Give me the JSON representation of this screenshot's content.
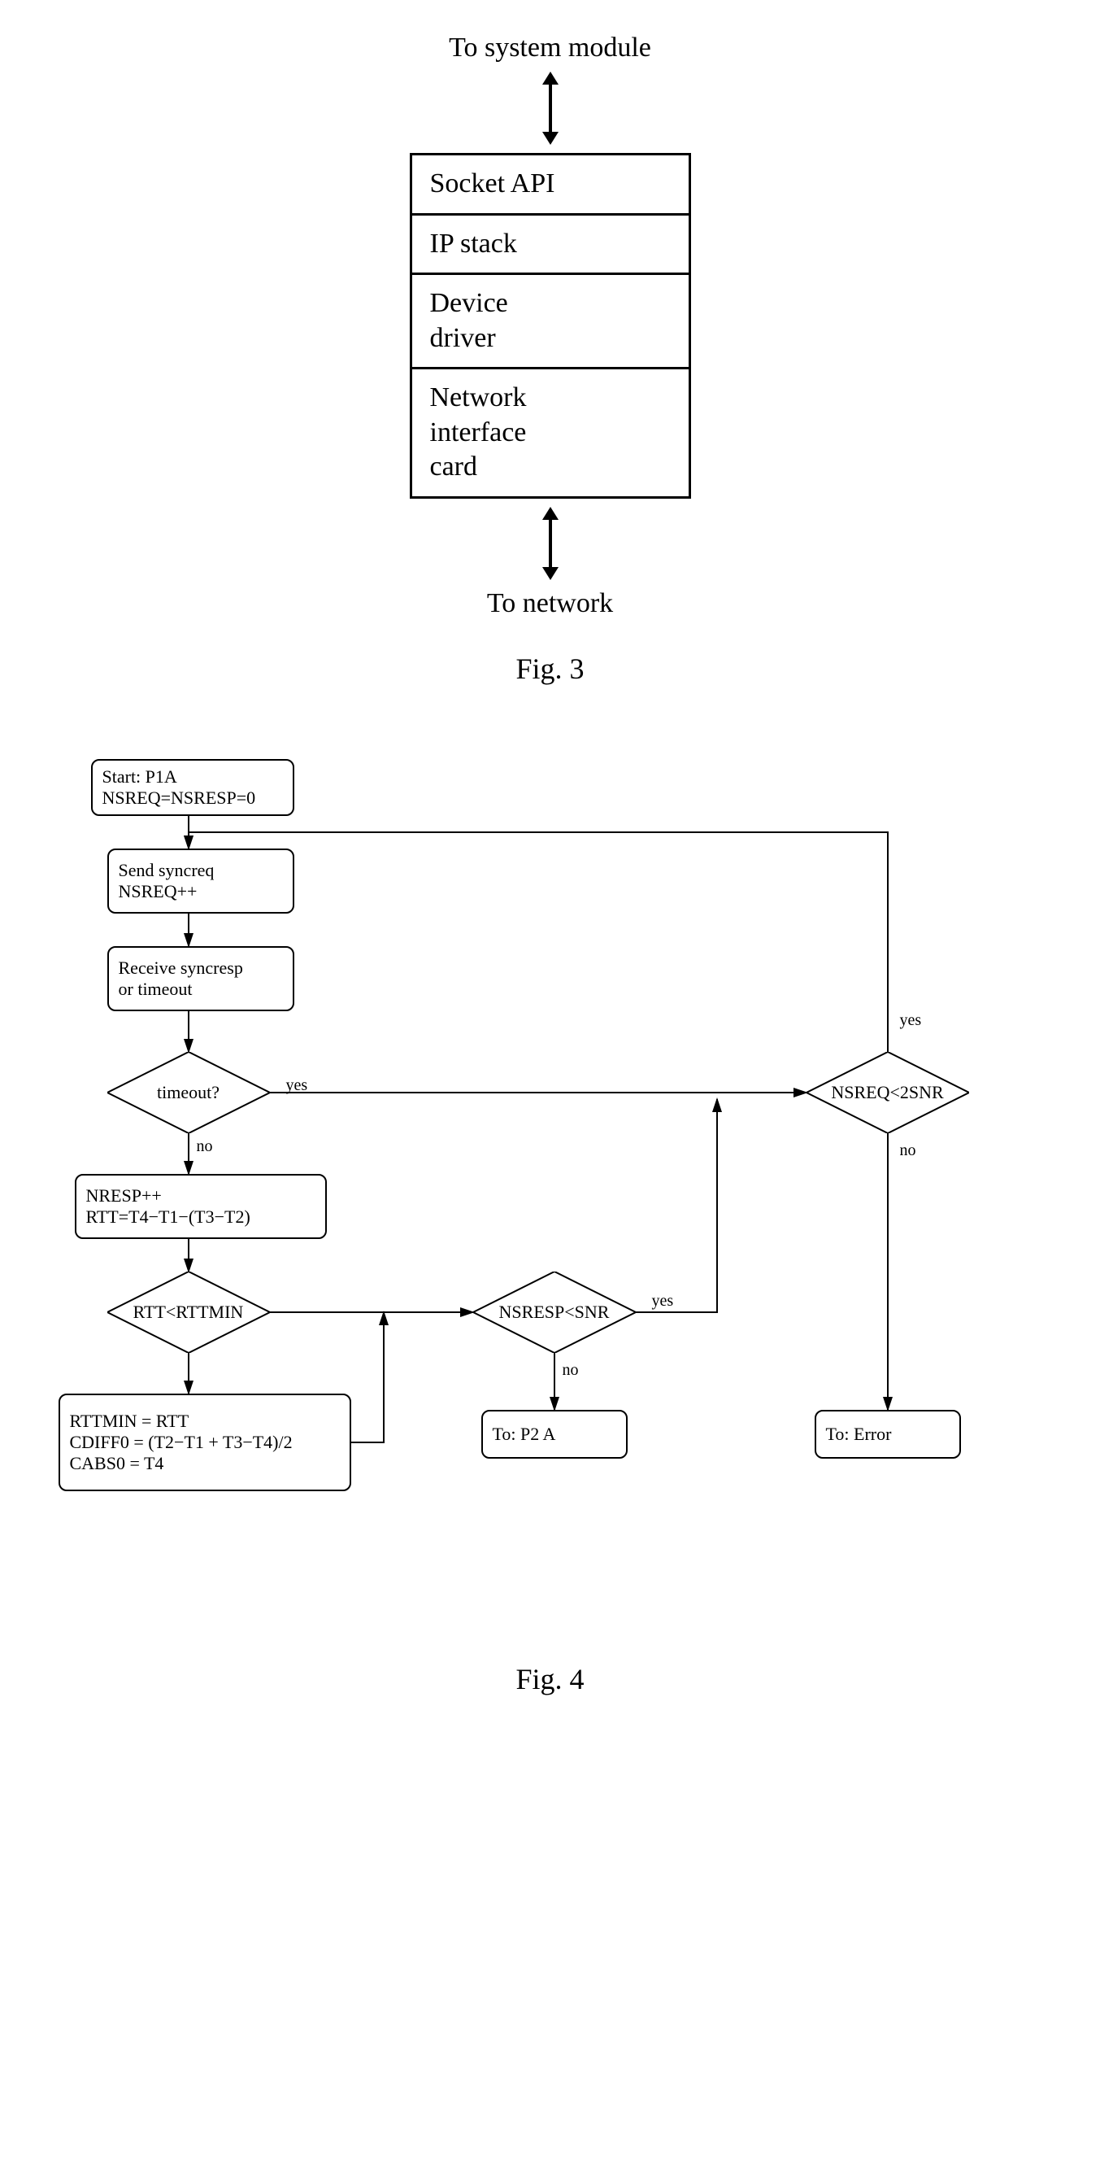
{
  "fig3": {
    "top": "To system module",
    "layers": [
      "Socket API",
      "IP stack",
      "Device\ndriver",
      "Network\ninterface\ncard"
    ],
    "bottom": "To network",
    "caption": "Fig. 3"
  },
  "fig4": {
    "start": "Start: P1A\nNSREQ=NSRESP=0",
    "send": "Send syncreq\nNSREQ++",
    "recv": "Receive syncresp\nor timeout",
    "timeout_q": "timeout?",
    "nresp": "NRESP++\nRTT=T4−T1−(T3−T2)",
    "rtt_q": "RTT<RTTMIN",
    "rttmin_calc": "RTTMIN = RTT\nCDIFF0 = (T2−T1 + T3−T4)/2\nCABS0 = T4",
    "nsresp_q": "NSRESP<SNR",
    "nsreq_q": "NSREQ<2SNR",
    "to_p2a": "To:  P2 A",
    "to_err": "To:  Error",
    "yes": "yes",
    "no": "no",
    "caption": "Fig. 4"
  },
  "chart_data": {
    "type": "diagram",
    "figures": [
      {
        "name": "Fig. 3",
        "description": "Layered network stack with bidirectional arrows to system module (top) and to network (bottom).",
        "layers_top_to_bottom": [
          "Socket API",
          "IP stack",
          "Device driver",
          "Network interface card"
        ]
      },
      {
        "name": "Fig. 4",
        "description": "Flowchart for clock-sync request loop",
        "nodes": [
          {
            "id": "start",
            "type": "process",
            "text": "Start: P1A; NSREQ=NSRESP=0"
          },
          {
            "id": "send",
            "type": "process",
            "text": "Send syncreq; NSREQ++"
          },
          {
            "id": "recv",
            "type": "process",
            "text": "Receive syncresp or timeout"
          },
          {
            "id": "timeout",
            "type": "decision",
            "text": "timeout?"
          },
          {
            "id": "nresp",
            "type": "process",
            "text": "NRESP++; RTT=T4-T1-(T3-T2)"
          },
          {
            "id": "rttq",
            "type": "decision",
            "text": "RTT<RTTMIN"
          },
          {
            "id": "calc",
            "type": "process",
            "text": "RTTMIN=RTT; CDIFF0=(T2-T1+T3-T4)/2; CABS0=T4"
          },
          {
            "id": "nsrespq",
            "type": "decision",
            "text": "NSRESP<SNR"
          },
          {
            "id": "nsreqq",
            "type": "decision",
            "text": "NSREQ<2SNR"
          },
          {
            "id": "p2a",
            "type": "terminal",
            "text": "To: P2 A"
          },
          {
            "id": "error",
            "type": "terminal",
            "text": "To: Error"
          }
        ],
        "edges": [
          {
            "from": "start",
            "to": "send"
          },
          {
            "from": "send",
            "to": "recv"
          },
          {
            "from": "recv",
            "to": "timeout"
          },
          {
            "from": "timeout",
            "to": "nsreqq",
            "label": "yes"
          },
          {
            "from": "timeout",
            "to": "nresp",
            "label": "no"
          },
          {
            "from": "nresp",
            "to": "rttq"
          },
          {
            "from": "rttq",
            "to": "calc",
            "label": "true"
          },
          {
            "from": "rttq",
            "to": "nsrespq",
            "label": "false"
          },
          {
            "from": "calc",
            "to": "nsrespq"
          },
          {
            "from": "nsrespq",
            "to": "nsreqq",
            "label": "yes"
          },
          {
            "from": "nsrespq",
            "to": "p2a",
            "label": "no"
          },
          {
            "from": "nsreqq",
            "to": "send",
            "label": "yes"
          },
          {
            "from": "nsreqq",
            "to": "error",
            "label": "no"
          }
        ]
      }
    ]
  }
}
